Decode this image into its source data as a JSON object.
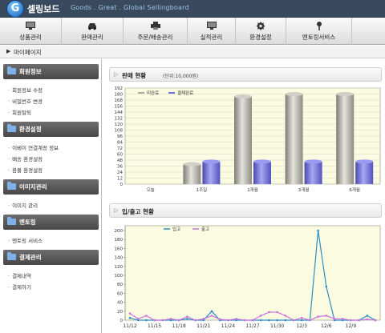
{
  "header": {
    "logo_letter": "G",
    "brand": "셀링보드",
    "tagline": "Goods . Great . Global  Sellingboard"
  },
  "menu": [
    {
      "label": "상품관리",
      "icon": "monitor-icon"
    },
    {
      "label": "판매관리",
      "icon": "car-icon"
    },
    {
      "label": "주문/배송관리",
      "icon": "printer-icon"
    },
    {
      "label": "실적관리",
      "icon": "monitor-icon"
    },
    {
      "label": "환경설정",
      "icon": "gear-icon"
    },
    {
      "label": "멘토링서비스",
      "icon": "pin-icon"
    }
  ],
  "breadcrumb": {
    "label": "마이페이지"
  },
  "sidebar": {
    "sections": [
      {
        "title": "회원정보",
        "items": [
          "회원정보 수정",
          "비밀번호 변경",
          "회원탈퇴"
        ]
      },
      {
        "title": "환경설정",
        "items": [
          "이베이 연결계정 정보",
          "배송 환경설정",
          "환불 환경설정"
        ]
      },
      {
        "title": "이미지관리",
        "items": [
          "이미지 관리"
        ]
      },
      {
        "title": "멘토링",
        "items": [
          "멘토링 서비스"
        ]
      },
      {
        "title": "결제관리",
        "items": [
          "결제내역",
          "결제하기"
        ]
      }
    ]
  },
  "colors": {
    "bar_pending": "#a9a9a1",
    "bar_done": "#6f6fd6",
    "line_in": "#2a8fc4",
    "line_out": "#c873d8",
    "plot_bg": "#fbfbe2"
  },
  "chart_data": [
    {
      "type": "bar",
      "title": "판매 현황",
      "unit_note": "(단위:10,000원)",
      "categories": [
        "오늘",
        "1주일",
        "1개월",
        "3개월",
        "6개월"
      ],
      "series": [
        {
          "name": "미완료",
          "values": [
            0,
            40,
            175,
            180,
            180
          ]
        },
        {
          "name": "결제완료",
          "values": [
            0,
            45,
            45,
            45,
            45
          ]
        }
      ],
      "yticks": [
        0,
        12,
        24,
        36,
        48,
        60,
        72,
        84,
        96,
        108,
        120,
        132,
        144,
        156,
        168,
        180,
        192
      ],
      "ylim": [
        0,
        192
      ],
      "legend": "top-left",
      "grid": true
    },
    {
      "type": "line",
      "title": "입/출고 현황",
      "x_labels": [
        "11/12",
        "11/15",
        "11/18",
        "11/21",
        "11/24",
        "11/27",
        "11/30",
        "12/3",
        "12/6",
        "12/9"
      ],
      "x": [
        0,
        1,
        2,
        3,
        4,
        5,
        6,
        7,
        8,
        9,
        10,
        11,
        12,
        13,
        14,
        15,
        16,
        17,
        18,
        19,
        20,
        21,
        22,
        23,
        24,
        25,
        26,
        27,
        28,
        29,
        30
      ],
      "series": [
        {
          "name": "입고",
          "values": [
            5,
            0,
            0,
            0,
            0,
            0,
            0,
            3,
            0,
            0,
            20,
            0,
            0,
            0,
            0,
            0,
            0,
            0,
            0,
            0,
            0,
            0,
            0,
            200,
            75,
            0,
            0,
            0,
            0,
            10,
            0
          ]
        },
        {
          "name": "출고",
          "values": [
            15,
            3,
            10,
            0,
            0,
            3,
            0,
            8,
            0,
            3,
            10,
            2,
            0,
            3,
            0,
            0,
            10,
            18,
            18,
            10,
            0,
            5,
            0,
            8,
            10,
            3,
            3,
            0,
            0,
            2,
            0
          ]
        }
      ],
      "yticks": [
        0,
        20,
        40,
        60,
        80,
        100,
        120,
        140,
        160,
        180,
        200
      ],
      "ylim": [
        0,
        200
      ],
      "legend": "top-left",
      "grid": false
    }
  ]
}
